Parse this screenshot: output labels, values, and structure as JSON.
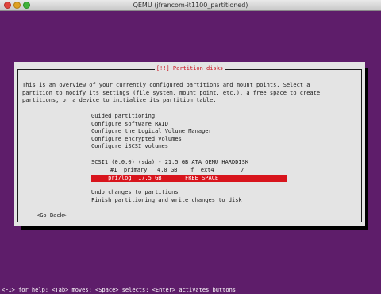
{
  "window": {
    "title": "QEMU (jfrancom-it1100_partitioned)"
  },
  "dialog": {
    "title": "[!!] Partition disks",
    "intro_lines": [
      "This is an overview of your currently configured partitions and mount points. Select a",
      "partition to modify its settings (file system, mount point, etc.), a free space to create",
      "partitions, or a device to initialize its partition table."
    ],
    "menu_top": [
      "Guided partitioning",
      "Configure software RAID",
      "Configure the Logical Volume Manager",
      "Configure encrypted volumes",
      "Configure iSCSI volumes"
    ],
    "disk": "SCSI1 (0,0,0) (sda) - 21.5 GB ATA QEMU HARDDISK",
    "partition": "#1  primary   4.0 GB    f  ext4        /",
    "free_space": "     pri/log  17.5 GB       FREE SPACE",
    "menu_bottom": [
      "Undo changes to partitions",
      "Finish partitioning and write changes to disk"
    ],
    "go_back": "<Go Back>"
  },
  "help_line": "<F1> for help; <Tab> moves; <Space> selects; <Enter> activates buttons",
  "colors": {
    "background": "#5e1d6a",
    "dialog": "#e4e4e4",
    "title_text": "#c8141f",
    "selection": "#d8141c"
  }
}
